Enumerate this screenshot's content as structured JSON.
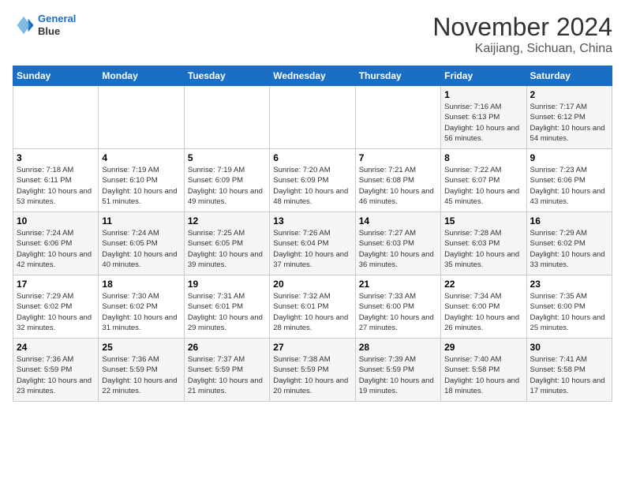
{
  "header": {
    "logo_line1": "General",
    "logo_line2": "Blue",
    "month": "November 2024",
    "location": "Kaijiang, Sichuan, China"
  },
  "days_of_week": [
    "Sunday",
    "Monday",
    "Tuesday",
    "Wednesday",
    "Thursday",
    "Friday",
    "Saturday"
  ],
  "weeks": [
    [
      {
        "day": "",
        "info": ""
      },
      {
        "day": "",
        "info": ""
      },
      {
        "day": "",
        "info": ""
      },
      {
        "day": "",
        "info": ""
      },
      {
        "day": "",
        "info": ""
      },
      {
        "day": "1",
        "info": "Sunrise: 7:16 AM\nSunset: 6:13 PM\nDaylight: 10 hours and 56 minutes."
      },
      {
        "day": "2",
        "info": "Sunrise: 7:17 AM\nSunset: 6:12 PM\nDaylight: 10 hours and 54 minutes."
      }
    ],
    [
      {
        "day": "3",
        "info": "Sunrise: 7:18 AM\nSunset: 6:11 PM\nDaylight: 10 hours and 53 minutes."
      },
      {
        "day": "4",
        "info": "Sunrise: 7:19 AM\nSunset: 6:10 PM\nDaylight: 10 hours and 51 minutes."
      },
      {
        "day": "5",
        "info": "Sunrise: 7:19 AM\nSunset: 6:09 PM\nDaylight: 10 hours and 49 minutes."
      },
      {
        "day": "6",
        "info": "Sunrise: 7:20 AM\nSunset: 6:09 PM\nDaylight: 10 hours and 48 minutes."
      },
      {
        "day": "7",
        "info": "Sunrise: 7:21 AM\nSunset: 6:08 PM\nDaylight: 10 hours and 46 minutes."
      },
      {
        "day": "8",
        "info": "Sunrise: 7:22 AM\nSunset: 6:07 PM\nDaylight: 10 hours and 45 minutes."
      },
      {
        "day": "9",
        "info": "Sunrise: 7:23 AM\nSunset: 6:06 PM\nDaylight: 10 hours and 43 minutes."
      }
    ],
    [
      {
        "day": "10",
        "info": "Sunrise: 7:24 AM\nSunset: 6:06 PM\nDaylight: 10 hours and 42 minutes."
      },
      {
        "day": "11",
        "info": "Sunrise: 7:24 AM\nSunset: 6:05 PM\nDaylight: 10 hours and 40 minutes."
      },
      {
        "day": "12",
        "info": "Sunrise: 7:25 AM\nSunset: 6:05 PM\nDaylight: 10 hours and 39 minutes."
      },
      {
        "day": "13",
        "info": "Sunrise: 7:26 AM\nSunset: 6:04 PM\nDaylight: 10 hours and 37 minutes."
      },
      {
        "day": "14",
        "info": "Sunrise: 7:27 AM\nSunset: 6:03 PM\nDaylight: 10 hours and 36 minutes."
      },
      {
        "day": "15",
        "info": "Sunrise: 7:28 AM\nSunset: 6:03 PM\nDaylight: 10 hours and 35 minutes."
      },
      {
        "day": "16",
        "info": "Sunrise: 7:29 AM\nSunset: 6:02 PM\nDaylight: 10 hours and 33 minutes."
      }
    ],
    [
      {
        "day": "17",
        "info": "Sunrise: 7:29 AM\nSunset: 6:02 PM\nDaylight: 10 hours and 32 minutes."
      },
      {
        "day": "18",
        "info": "Sunrise: 7:30 AM\nSunset: 6:02 PM\nDaylight: 10 hours and 31 minutes."
      },
      {
        "day": "19",
        "info": "Sunrise: 7:31 AM\nSunset: 6:01 PM\nDaylight: 10 hours and 29 minutes."
      },
      {
        "day": "20",
        "info": "Sunrise: 7:32 AM\nSunset: 6:01 PM\nDaylight: 10 hours and 28 minutes."
      },
      {
        "day": "21",
        "info": "Sunrise: 7:33 AM\nSunset: 6:00 PM\nDaylight: 10 hours and 27 minutes."
      },
      {
        "day": "22",
        "info": "Sunrise: 7:34 AM\nSunset: 6:00 PM\nDaylight: 10 hours and 26 minutes."
      },
      {
        "day": "23",
        "info": "Sunrise: 7:35 AM\nSunset: 6:00 PM\nDaylight: 10 hours and 25 minutes."
      }
    ],
    [
      {
        "day": "24",
        "info": "Sunrise: 7:36 AM\nSunset: 5:59 PM\nDaylight: 10 hours and 23 minutes."
      },
      {
        "day": "25",
        "info": "Sunrise: 7:36 AM\nSunset: 5:59 PM\nDaylight: 10 hours and 22 minutes."
      },
      {
        "day": "26",
        "info": "Sunrise: 7:37 AM\nSunset: 5:59 PM\nDaylight: 10 hours and 21 minutes."
      },
      {
        "day": "27",
        "info": "Sunrise: 7:38 AM\nSunset: 5:59 PM\nDaylight: 10 hours and 20 minutes."
      },
      {
        "day": "28",
        "info": "Sunrise: 7:39 AM\nSunset: 5:59 PM\nDaylight: 10 hours and 19 minutes."
      },
      {
        "day": "29",
        "info": "Sunrise: 7:40 AM\nSunset: 5:58 PM\nDaylight: 10 hours and 18 minutes."
      },
      {
        "day": "30",
        "info": "Sunrise: 7:41 AM\nSunset: 5:58 PM\nDaylight: 10 hours and 17 minutes."
      }
    ]
  ]
}
